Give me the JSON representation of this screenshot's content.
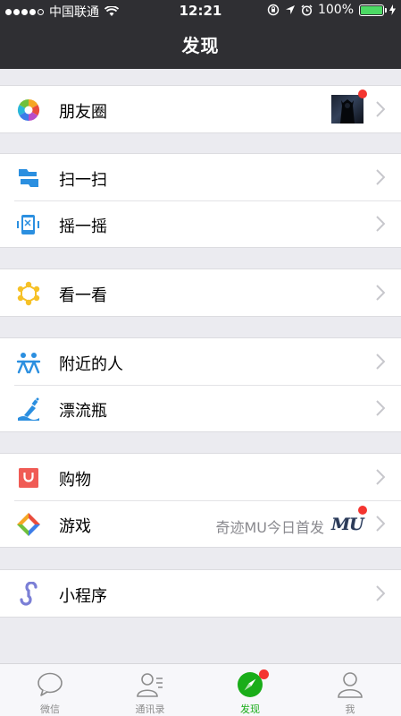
{
  "status_bar": {
    "carrier": "中国联通",
    "time": "12:21",
    "battery": "100%"
  },
  "nav": {
    "title": "发现"
  },
  "sections": {
    "moments": {
      "label": "朋友圈",
      "has_badge": true
    },
    "scan": {
      "label": "扫一扫"
    },
    "shake": {
      "label": "摇一摇"
    },
    "look": {
      "label": "看一看"
    },
    "nearby": {
      "label": "附近的人"
    },
    "bottle": {
      "label": "漂流瓶"
    },
    "shopping": {
      "label": "购物"
    },
    "games": {
      "label": "游戏",
      "subtitle": "奇迹MU今日首发",
      "logo_text": "MU",
      "has_badge": true
    },
    "miniprogram": {
      "label": "小程序"
    }
  },
  "tabbar": {
    "tabs": [
      {
        "label": "微信",
        "icon": "chat-bubble-icon"
      },
      {
        "label": "通讯录",
        "icon": "contacts-icon"
      },
      {
        "label": "发现",
        "icon": "compass-icon",
        "active": true,
        "has_badge": true
      },
      {
        "label": "我",
        "icon": "person-icon"
      }
    ]
  },
  "colors": {
    "accent": "#1aad19",
    "badge": "#f43530",
    "header": "#2f2f33"
  }
}
